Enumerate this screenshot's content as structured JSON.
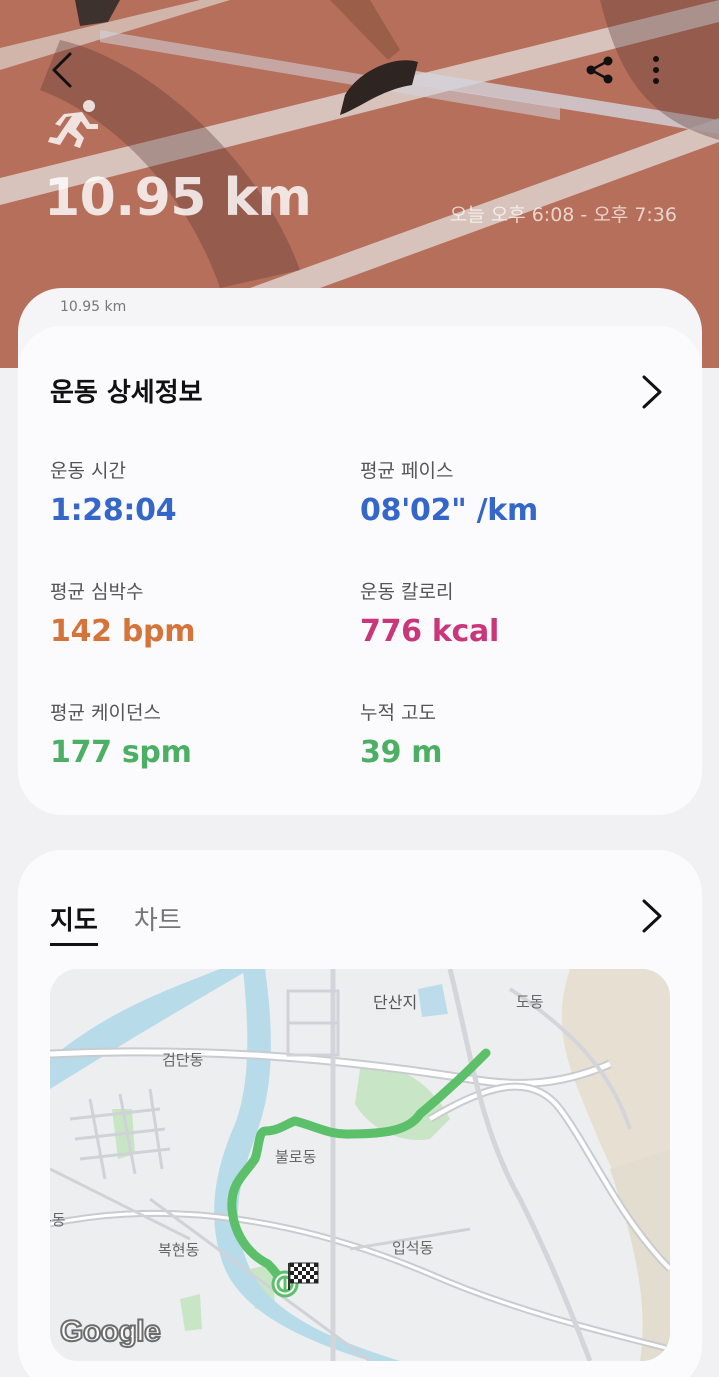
{
  "header": {
    "distance": "10.95 km",
    "time_range": "오늘 오후 6:08 - 오후 7:36",
    "sheet_distance": "10.95 km"
  },
  "detail": {
    "title": "운동 상세정보",
    "stats": [
      {
        "label": "운동 시간",
        "value": "1:28:04",
        "color": "#3566c9"
      },
      {
        "label": "평균 페이스",
        "value": "08'02\" /km",
        "color": "#3566c9"
      },
      {
        "label": "평균 심박수",
        "value": "142 bpm",
        "color": "#d4733a"
      },
      {
        "label": "운동 칼로리",
        "value": "776 kcal",
        "color": "#c9367a"
      },
      {
        "label": "평균 케이던스",
        "value": "177 spm",
        "color": "#4caf63"
      },
      {
        "label": "누적 고도",
        "value": "39 m",
        "color": "#4caf63"
      }
    ]
  },
  "map_card": {
    "tabs": [
      "지도",
      "차트"
    ],
    "active_tab": "지도",
    "labels": [
      "단산지",
      "도동",
      "검단동",
      "불로동",
      "복현동",
      "입석동",
      "복동"
    ],
    "attribution": "Google",
    "route_color": "#5cc06a"
  },
  "icons": [
    "back-icon",
    "share-icon",
    "more-icon",
    "running-icon",
    "chevron-right-icon",
    "finish-flag-icon",
    "start-marker-icon"
  ]
}
